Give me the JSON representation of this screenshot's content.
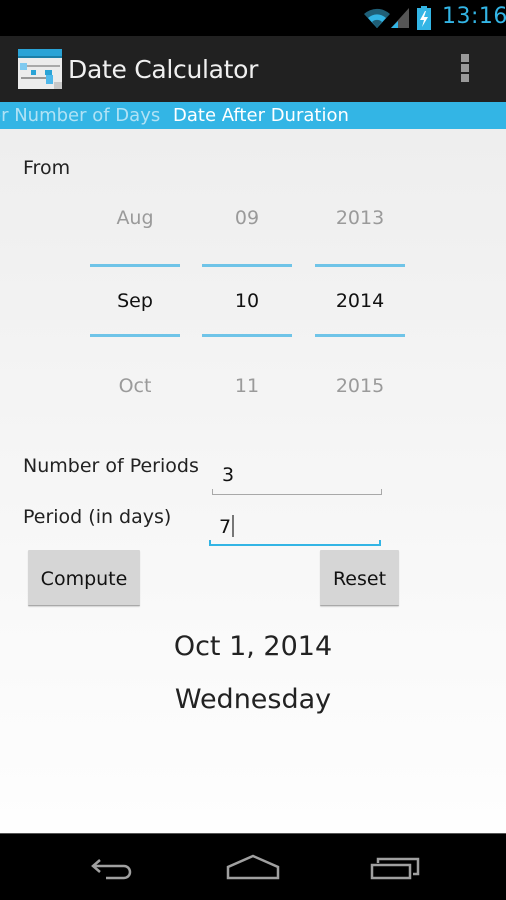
{
  "status_bar": {
    "time": "13:16",
    "icons": [
      "wifi-icon",
      "signal-icon",
      "battery-charging-icon"
    ],
    "accent_color": "#33b5e5"
  },
  "action_bar": {
    "title": "Date Calculator",
    "app_icon": "calendar-calculator-icon",
    "overflow_icon": "overflow-menu-icon"
  },
  "tabs": [
    {
      "label": "Date After Number of Days",
      "visible_text": "er Number of Days",
      "active": false
    },
    {
      "label": "Date After Duration",
      "active": true
    }
  ],
  "form": {
    "from_label": "From",
    "date_picker": {
      "month": {
        "prev": "Aug",
        "current": "Sep",
        "next": "Oct"
      },
      "day": {
        "prev": "09",
        "current": "10",
        "next": "11"
      },
      "year": {
        "prev": "2013",
        "current": "2014",
        "next": "2015"
      }
    },
    "number_of_periods": {
      "label": "Number of Periods",
      "value": "3"
    },
    "period_days": {
      "label": "Period (in days)",
      "value": "7"
    },
    "compute_label": "Compute",
    "reset_label": "Reset"
  },
  "result": {
    "date": "Oct 1, 2014",
    "weekday": "Wednesday"
  },
  "nav_bar": {
    "buttons": [
      "back-icon",
      "home-icon",
      "recents-icon"
    ]
  }
}
